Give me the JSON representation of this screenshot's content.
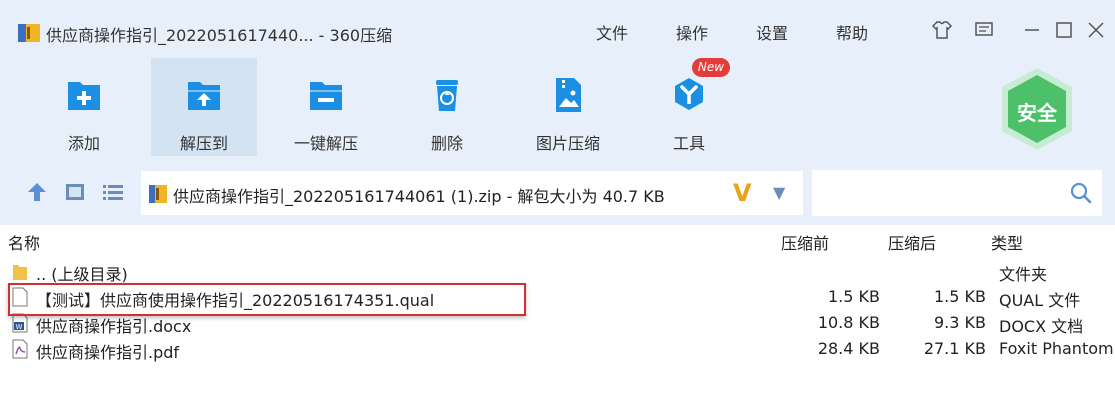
{
  "window": {
    "title": "供应商操作指引_2022051617440... - 360压缩",
    "menu": [
      "文件",
      "操作",
      "设置",
      "帮助"
    ]
  },
  "toolbar": {
    "buttons": [
      {
        "label": "添加",
        "icon": "add-icon"
      },
      {
        "label": "解压到",
        "icon": "extract-to-icon"
      },
      {
        "label": "一键解压",
        "icon": "one-click-extract-icon"
      },
      {
        "label": "删除",
        "icon": "delete-icon"
      },
      {
        "label": "图片压缩",
        "icon": "image-compress-icon"
      },
      {
        "label": "工具",
        "icon": "tools-icon"
      }
    ],
    "new_badge": "New",
    "safe_label": "安全"
  },
  "address": {
    "text": "供应商操作指引_202205161744061 (1).zip - 解包大小为 40.7 KB"
  },
  "columns": {
    "name": "名称",
    "compressed": "压缩前",
    "uncompressed": "压缩后",
    "type": "类型"
  },
  "files": [
    {
      "name": ".. (上级目录)",
      "size_before": "",
      "size_after": "",
      "type": "文件夹",
      "icon": "folder-icon"
    },
    {
      "name": "【测试】供应商使用操作指引_20220516174351.qual",
      "size_before": "1.5 KB",
      "size_after": "1.5 KB",
      "type": "QUAL 文件",
      "icon": "blank-file-icon"
    },
    {
      "name": "供应商操作指引.docx",
      "size_before": "10.8 KB",
      "size_after": "9.3 KB",
      "type": "DOCX 文档",
      "icon": "word-doc-icon"
    },
    {
      "name": "供应商操作指引.pdf",
      "size_before": "28.4 KB",
      "size_after": "27.1 KB",
      "type": "Foxit Phantom",
      "icon": "pdf-icon"
    }
  ],
  "colors": {
    "toolbar_bg": "#e7f0fa",
    "icon_blue": "#1a8fe3",
    "highlight_red": "#d32f2f",
    "safe_green": "#4cc16a"
  }
}
